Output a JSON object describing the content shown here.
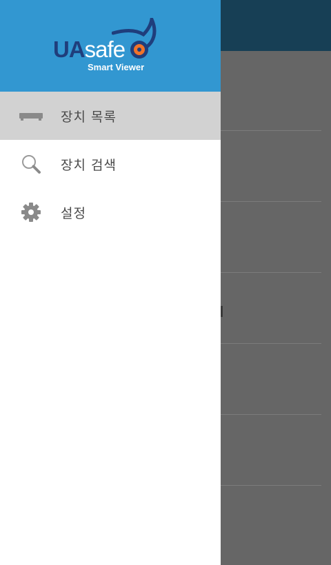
{
  "header": {
    "logo_ua": "UA",
    "logo_safe": "safe",
    "logo_subtitle": "Smart Viewer"
  },
  "menu": {
    "items": [
      {
        "label": "장치 목록",
        "icon": "dvr-device-icon",
        "active": true
      },
      {
        "label": "장치 검색",
        "icon": "search-icon",
        "active": false
      },
      {
        "label": "설정",
        "icon": "gear-icon",
        "active": false
      }
    ]
  },
  "colors": {
    "header_bg": "#3297d1",
    "logo_dark": "#1f3e7c",
    "logo_orange": "#f0732a",
    "active_item_bg": "#d2d2d2",
    "scrim": "#666666",
    "topbar": "#173f55"
  }
}
